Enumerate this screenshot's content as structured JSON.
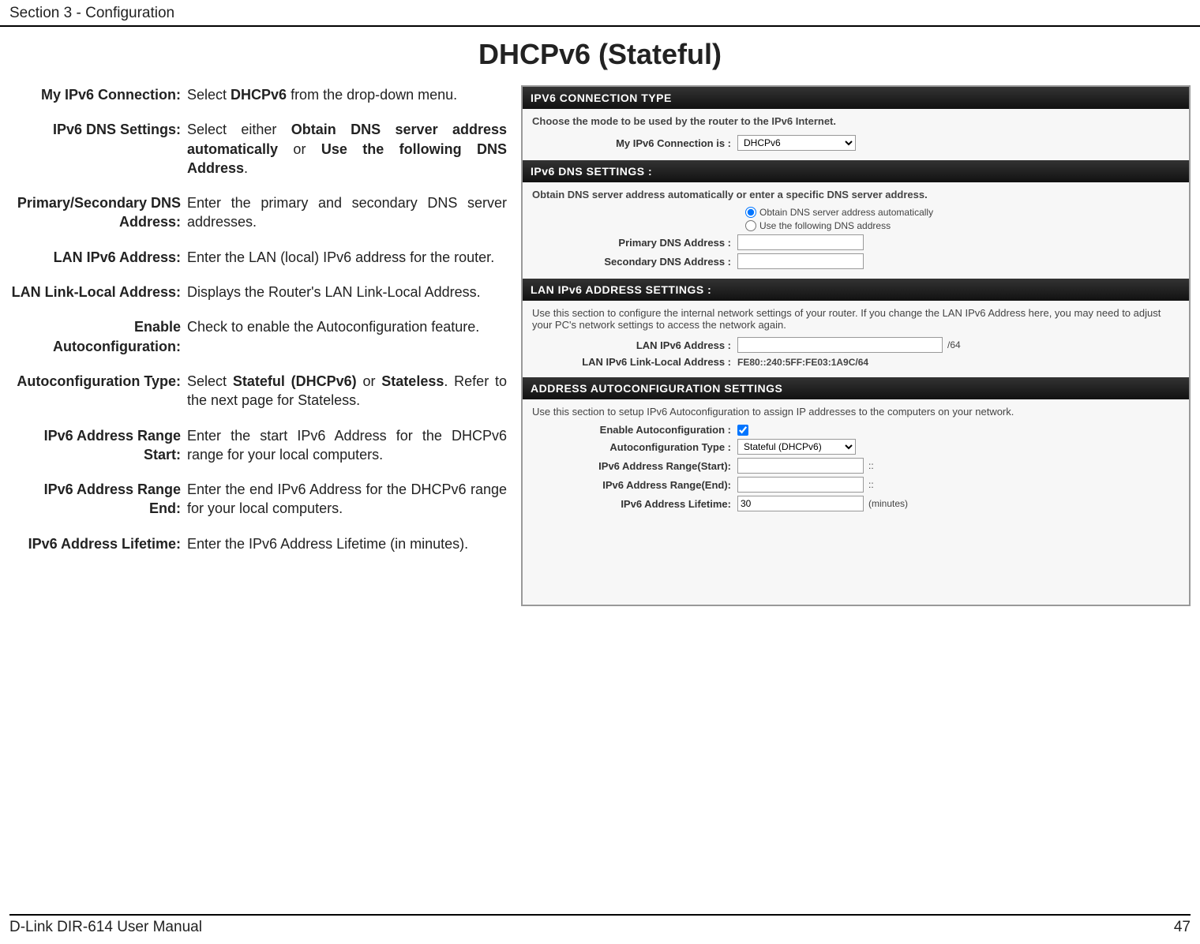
{
  "header": {
    "section": "Section 3 - Configuration"
  },
  "title": "DHCPv6 (Stateful)",
  "rows": [
    {
      "label": "My IPv6 Connection:",
      "desc": "Select <b>DHCPv6</b> from the drop-down menu."
    },
    {
      "label": "IPv6 DNS Settings:",
      "desc": "Select either <b>Obtain DNS server address automatically</b> or <b>Use the following DNS Address</b>."
    },
    {
      "label": "Primary/Secondary DNS Address:",
      "desc": "Enter the primary and secondary DNS server addresses."
    },
    {
      "label": "LAN IPv6 Address:",
      "desc": "Enter the LAN (local) IPv6 address for the router."
    },
    {
      "label": "LAN Link-Local Address:",
      "desc": "Displays the Router's LAN Link-Local Address."
    },
    {
      "label": "Enable Autoconfiguration:",
      "desc": "Check to enable the Autoconfiguration feature."
    },
    {
      "label": "Autoconfiguration Type:",
      "desc": "Select <b>Stateful (DHCPv6)</b> or <b>Stateless</b>. Refer to the next page for Stateless."
    },
    {
      "label": "IPv6 Address Range Start:",
      "desc": "Enter the start IPv6 Address for the DHCPv6 range for your local computers."
    },
    {
      "label": "IPv6 Address Range End:",
      "desc": "Enter the end IPv6 Address for the DHCPv6 range for your local computers."
    },
    {
      "label": "IPv6 Address Lifetime:",
      "desc": "Enter the IPv6 Address Lifetime (in minutes)."
    }
  ],
  "panel": {
    "s1": {
      "head": "IPV6 CONNECTION TYPE",
      "intro": "Choose the mode to be used by the router to the IPv6 Internet.",
      "conn_label": "My IPv6 Connection is :",
      "conn_val": "DHCPv6"
    },
    "s2": {
      "head": "IPv6 DNS SETTINGS :",
      "intro": "Obtain DNS server address automatically or enter a specific DNS server address.",
      "r1": "Obtain DNS server address automatically",
      "r2": "Use the following DNS address",
      "p_label": "Primary DNS Address :",
      "s_label": "Secondary DNS Address :"
    },
    "s3": {
      "head": "LAN IPv6 ADDRESS SETTINGS :",
      "intro": "Use this section to configure the internal network settings of your router. If you change the LAN IPv6 Address here, you may need to adjust your PC's network settings to access the network again.",
      "lan_label": "LAN IPv6 Address :",
      "lan_suffix": "/64",
      "ll_label": "LAN IPv6 Link-Local Address :",
      "ll_val": "FE80::240:5FF:FE03:1A9C/64"
    },
    "s4": {
      "head": "ADDRESS AUTOCONFIGURATION SETTINGS",
      "intro": "Use this section to setup IPv6 Autoconfiguration to assign IP addresses to the computers on your network.",
      "en_label": "Enable Autoconfiguration :",
      "type_label": "Autoconfiguration Type :",
      "type_val": "Stateful (DHCPv6)",
      "rs_label": "IPv6 Address Range(Start):",
      "re_label": "IPv6 Address Range(End):",
      "lt_label": "IPv6 Address Lifetime:",
      "lt_val": "30",
      "lt_unit": "(minutes)",
      "sep": "::"
    }
  },
  "footer": {
    "left": "D-Link DIR-614 User Manual",
    "right": "47"
  }
}
